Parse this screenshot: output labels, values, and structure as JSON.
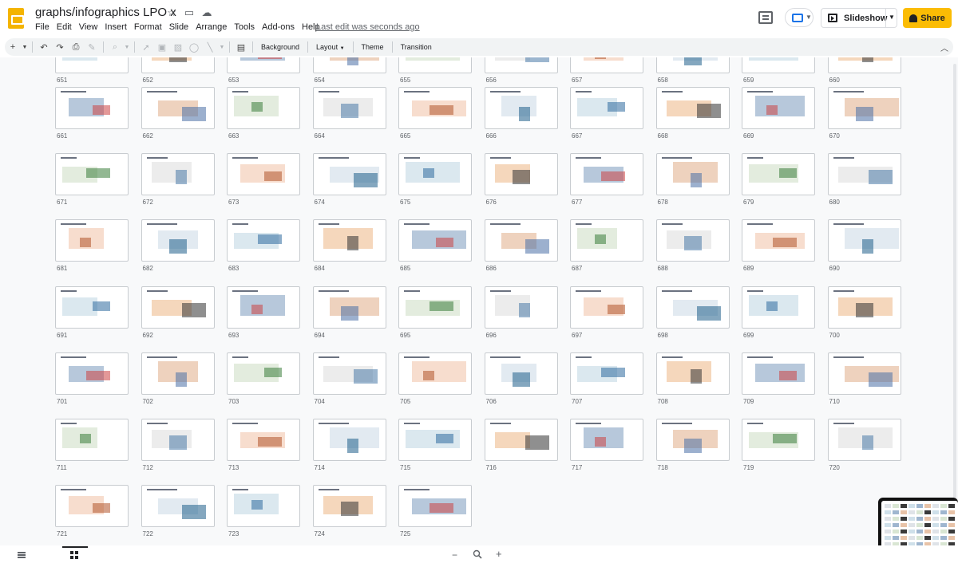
{
  "app": {
    "doc_title": "graphs/infographics LPO x",
    "last_edit": "Last edit was seconds ago"
  },
  "menu": [
    "File",
    "Edit",
    "View",
    "Insert",
    "Format",
    "Slide",
    "Arrange",
    "Tools",
    "Add-ons",
    "Help"
  ],
  "header": {
    "slideshow_label": "Slideshow",
    "share_label": "Share"
  },
  "toolbar": {
    "background_label": "Background",
    "layout_label": "Layout",
    "theme_label": "Theme",
    "transition_label": "Transition"
  },
  "slides": [
    "651",
    "652",
    "653",
    "654",
    "655",
    "656",
    "657",
    "658",
    "659",
    "660",
    "661",
    "662",
    "663",
    "664",
    "665",
    "666",
    "667",
    "668",
    "669",
    "670",
    "671",
    "672",
    "673",
    "674",
    "675",
    "676",
    "677",
    "678",
    "679",
    "680",
    "681",
    "682",
    "683",
    "684",
    "685",
    "686",
    "687",
    "688",
    "689",
    "690",
    "691",
    "692",
    "693",
    "694",
    "695",
    "696",
    "697",
    "698",
    "699",
    "700",
    "701",
    "702",
    "703",
    "704",
    "705",
    "706",
    "707",
    "708",
    "709",
    "710",
    "711",
    "712",
    "713",
    "714",
    "715",
    "716",
    "717",
    "718",
    "719",
    "720",
    "721",
    "722",
    "723",
    "724",
    "725"
  ],
  "colors": {
    "accent_yellow": "#fbbc04",
    "logo_yellow": "#f4b400",
    "present_blue": "#1a73e8",
    "grid_bg": "#f8f9fa"
  },
  "icons": {
    "star": "star-icon",
    "folder": "move-folder-icon",
    "cloud": "cloud-status-icon",
    "comments": "comments-icon",
    "present": "present-icon",
    "slideshow": "slideshow-play-icon",
    "share": "share-lock-icon",
    "list_view": "list-view-icon",
    "grid_view": "grid-view-icon",
    "zoom": "zoom-icon"
  }
}
